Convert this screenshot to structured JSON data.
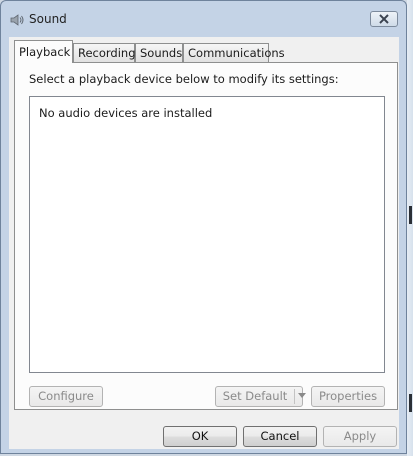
{
  "window": {
    "title": "Sound"
  },
  "tabs": [
    {
      "label": "Playback",
      "active": true
    },
    {
      "label": "Recording",
      "active": false
    },
    {
      "label": "Sounds",
      "active": false
    },
    {
      "label": "Communications",
      "active": false
    }
  ],
  "playback": {
    "prompt": "Select a playback device below to modify its settings:",
    "empty_message": "No audio devices are installed",
    "configure_label": "Configure",
    "set_default_label": "Set Default",
    "properties_label": "Properties"
  },
  "footer": {
    "ok_label": "OK",
    "cancel_label": "Cancel",
    "apply_label": "Apply"
  },
  "icons": {
    "app": "speaker-icon",
    "close": "close-icon",
    "dropdown": "chevron-down-icon"
  }
}
